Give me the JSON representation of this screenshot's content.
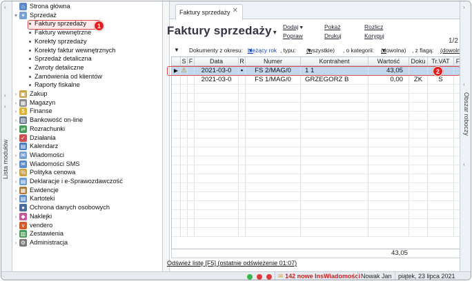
{
  "left_panel": {
    "label": "Lista modułów"
  },
  "right_panel": {
    "label": "Obszar roboczy"
  },
  "modules": [
    {
      "label": "Strona główna",
      "level": 0,
      "icon": "home-icon",
      "color": "#5a8ac8",
      "glyph": "⌂",
      "expander": ""
    },
    {
      "label": "Sprzedaż",
      "level": 0,
      "icon": "sales-icon",
      "color": "#7aa0d0",
      "glyph": "✦",
      "expander": "▾"
    },
    {
      "label": "Faktury sprzedaży",
      "level": 1,
      "selected": true
    },
    {
      "label": "Faktury wewnętrzne",
      "level": 1
    },
    {
      "label": "Korekty sprzedaży",
      "level": 1
    },
    {
      "label": "Korekty faktur wewnętrznych",
      "level": 1
    },
    {
      "label": "Sprzedaż detaliczna",
      "level": 1
    },
    {
      "label": "Zwroty detaliczne",
      "level": 1
    },
    {
      "label": "Zamówienia od klientów",
      "level": 1
    },
    {
      "label": "Raporty fiskalne",
      "level": 1
    },
    {
      "label": "Zakup",
      "level": 0,
      "icon": "purchase-icon",
      "color": "#c9a24a",
      "glyph": "▣",
      "expander": "›"
    },
    {
      "label": "Magazyn",
      "level": 0,
      "icon": "warehouse-icon",
      "color": "#8a8a8a",
      "glyph": "▦",
      "expander": "›"
    },
    {
      "label": "Finanse",
      "level": 0,
      "icon": "finance-icon",
      "color": "#d9b23a",
      "glyph": "$",
      "expander": "›"
    },
    {
      "label": "Bankowość on-line",
      "level": 0,
      "icon": "bank-icon",
      "color": "#6a7d95",
      "glyph": "▥",
      "expander": "›"
    },
    {
      "label": "Rozrachunki",
      "level": 0,
      "icon": "settlements-icon",
      "color": "#4a9a5a",
      "glyph": "⇄",
      "expander": "›"
    },
    {
      "label": "Działania",
      "level": 0,
      "icon": "actions-icon",
      "color": "#c85050",
      "glyph": "✓",
      "expander": "›"
    },
    {
      "label": "Kalendarz",
      "level": 0,
      "icon": "calendar-icon",
      "color": "#4a7ac0",
      "glyph": "▤",
      "expander": "›"
    },
    {
      "label": "Wiadomości",
      "level": 0,
      "icon": "messages-icon",
      "color": "#7aa0d0",
      "glyph": "✉",
      "expander": "›"
    },
    {
      "label": "Wiadomości SMS",
      "level": 0,
      "icon": "sms-icon",
      "color": "#5a8ac8",
      "glyph": "✉",
      "expander": "›"
    },
    {
      "label": "Polityka cenowa",
      "level": 0,
      "icon": "pricing-icon",
      "color": "#c9a24a",
      "glyph": "%",
      "expander": "›"
    },
    {
      "label": "Deklaracje i e-Sprawozdawczość",
      "level": 0,
      "icon": "declarations-icon",
      "color": "#6a9ad0",
      "glyph": "▤",
      "expander": "›"
    },
    {
      "label": "Ewidencje",
      "level": 0,
      "icon": "records-icon",
      "color": "#b07a3a",
      "glyph": "▦",
      "expander": "›"
    },
    {
      "label": "Kartoteki",
      "level": 0,
      "icon": "files-icon",
      "color": "#5a8ac8",
      "glyph": "▤",
      "expander": "›"
    },
    {
      "label": "Ochrona danych osobowych",
      "level": 0,
      "icon": "privacy-icon",
      "color": "#4a6a9a",
      "glyph": "●",
      "expander": "›"
    },
    {
      "label": "Naklejki",
      "level": 0,
      "icon": "stickers-icon",
      "color": "#c05a9a",
      "glyph": "◆",
      "expander": "›"
    },
    {
      "label": "vendero",
      "level": 0,
      "icon": "vendero-icon",
      "color": "#d05a2a",
      "glyph": "v",
      "expander": "›"
    },
    {
      "label": "Zestawienia",
      "level": 0,
      "icon": "reports-icon",
      "color": "#4a9a5a",
      "glyph": "▥",
      "expander": "›"
    },
    {
      "label": "Administracja",
      "level": 0,
      "icon": "admin-icon",
      "color": "#7a7a7a",
      "glyph": "⚙",
      "expander": "›"
    }
  ],
  "tab": {
    "label": "Faktury sprzedaży",
    "close": "✕"
  },
  "page": {
    "title": "Faktury sprzedaży",
    "title_caret": "▾"
  },
  "actions": {
    "add": "Dodaj",
    "show": "Pokaż",
    "settle": "Rozlicz",
    "fix": "Popraw",
    "print": "Drukuj",
    "correct": "Koryguj"
  },
  "filters": {
    "period_label": "Dokumenty z okresu:",
    "period_value": "bieżący rok",
    "type_label": ", typu:",
    "type_value": "(wszystkie)",
    "category_label": ", o kategorii:",
    "category_value": "(dowolna)",
    "flag_label": ", z flagą:",
    "flag_value": "(dowoln",
    "side_value": "1/2"
  },
  "grid": {
    "columns": [
      {
        "key": "s",
        "label": "S"
      },
      {
        "key": "f",
        "label": "F"
      },
      {
        "key": "date",
        "label": "Data"
      },
      {
        "key": "r",
        "label": "R"
      },
      {
        "key": "number",
        "label": "Numer"
      },
      {
        "key": "contractor",
        "label": "Kontrahent"
      },
      {
        "key": "value",
        "label": "Wartość"
      },
      {
        "key": "doc",
        "label": "Doku"
      },
      {
        "key": "vat",
        "label": "Tr.VAT"
      },
      {
        "key": "fz",
        "label": "F"
      }
    ],
    "rows": [
      {
        "s": "⚠",
        "f": "",
        "date": "2021-03-0",
        "r": "▪",
        "number": "FS 2/MAG/0",
        "contractor": "1 1",
        "value": "43,05",
        "doc": "",
        "vat": "",
        "fz": ""
      },
      {
        "s": "",
        "f": "",
        "date": "2021-03-0",
        "r": "",
        "number": "FS 1/MAG/0",
        "contractor": "GRZEGORZ B",
        "value": "0,00",
        "doc": "ZK",
        "vat": "S",
        "fz": ""
      }
    ],
    "total": "43,05"
  },
  "refresh_link": "Odśwież listę [F5] (ostatnie odświeżenie 01:07)",
  "status": {
    "notifications": "142 nowe InsWiadomości",
    "user": "Nowak Jan",
    "date": "piątek, 23 lipca 2021"
  },
  "annotations": {
    "badge_1": "1",
    "badge_2": "2"
  }
}
